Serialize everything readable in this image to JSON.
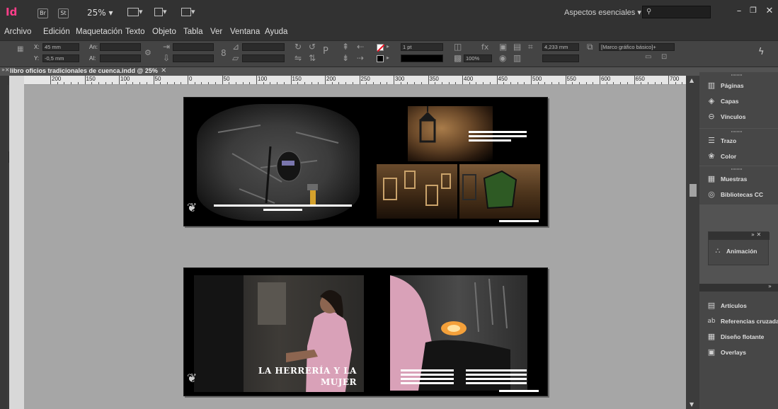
{
  "titlebar": {
    "logo": "Id",
    "bridge_button": "Br",
    "stock_button": "St",
    "zoom_level": "25%",
    "workspace": "Aspectos esenciales",
    "search_placeholder": ""
  },
  "menu": [
    "Archivo",
    "Edición",
    "Maquetación",
    "Texto",
    "Objeto",
    "Tabla",
    "Ver",
    "Ventana",
    "Ayuda"
  ],
  "control_panel": {
    "x_label": "X:",
    "x_value": "45 mm",
    "y_label": "Y:",
    "y_value": "-0,5 mm",
    "w_label": "An:",
    "h_label": "Al:",
    "stroke_weight": "1 pt",
    "opacity": "100%",
    "offset_value": "4,233 mm",
    "frame_style": "[Marco gráfico básico]+"
  },
  "document_tab": {
    "label": "libro oficios tradicionales de cuenca.indd @ 25%",
    "close": "×"
  },
  "ruler": {
    "labels": [
      "200",
      "150",
      "100",
      "50",
      "0",
      "50",
      "100",
      "150",
      "200",
      "250",
      "300",
      "350",
      "400",
      "450",
      "500",
      "550",
      "600",
      "650",
      "700"
    ]
  },
  "spread2": {
    "title_line1": "LA HERRERÍA Y LA",
    "title_line2": "MUJER"
  },
  "right_panels": {
    "group1": [
      "Páginas",
      "Capas",
      "Vínculos"
    ],
    "group2": [
      "Trazo",
      "Color"
    ],
    "group3": [
      "Muestras",
      "Bibliotecas CC"
    ],
    "floating": "Animación",
    "group4": [
      "Artículos",
      "Referencias cruzadas",
      "Diseño flotante",
      "Overlays"
    ]
  },
  "colors": {
    "app_chrome": "#323232",
    "pasteboard": "#a6a6a6",
    "indesign_pink": "#ff3e8a"
  }
}
